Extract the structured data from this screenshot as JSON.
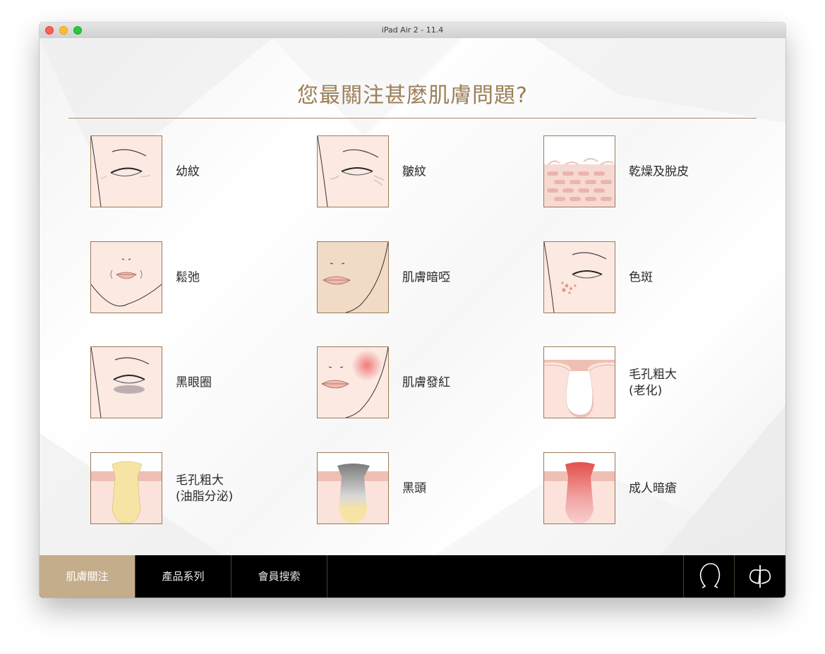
{
  "window": {
    "title": "iPad Air 2 - 11.4"
  },
  "page": {
    "heading": "您最關注甚麼肌膚問題?",
    "accent_color": "#9b7f58"
  },
  "concerns": [
    {
      "label": "幼紋",
      "icon": "fine-lines-eye-icon"
    },
    {
      "label": "皺紋",
      "icon": "wrinkles-eye-icon"
    },
    {
      "label": "乾燥及脫皮",
      "icon": "dry-skin-cells-icon"
    },
    {
      "label": "鬆弛",
      "icon": "sagging-face-icon"
    },
    {
      "label": "肌膚暗啞",
      "icon": "dull-skin-face-icon"
    },
    {
      "label": "色斑",
      "icon": "dark-spots-eye-icon"
    },
    {
      "label": "黑眼圈",
      "icon": "dark-circles-eye-icon"
    },
    {
      "label": "肌膚發紅",
      "icon": "redness-face-icon"
    },
    {
      "label": "毛孔粗大",
      "sublabel": "(老化)",
      "icon": "pore-aging-icon"
    },
    {
      "label": "毛孔粗大",
      "sublabel": "(油脂分泌)",
      "icon": "pore-oily-icon"
    },
    {
      "label": "黑頭",
      "icon": "blackhead-pore-icon"
    },
    {
      "label": "成人暗瘡",
      "icon": "adult-acne-pore-icon"
    }
  ],
  "tabbar": {
    "tabs": [
      {
        "label": "肌膚關注",
        "active": true
      },
      {
        "label": "產品系列",
        "active": false
      },
      {
        "label": "會員搜索",
        "active": false
      }
    ],
    "right_icons": [
      "face-profile-icon",
      "brand-logo-icon"
    ],
    "active_color": "#c4ad8b"
  }
}
